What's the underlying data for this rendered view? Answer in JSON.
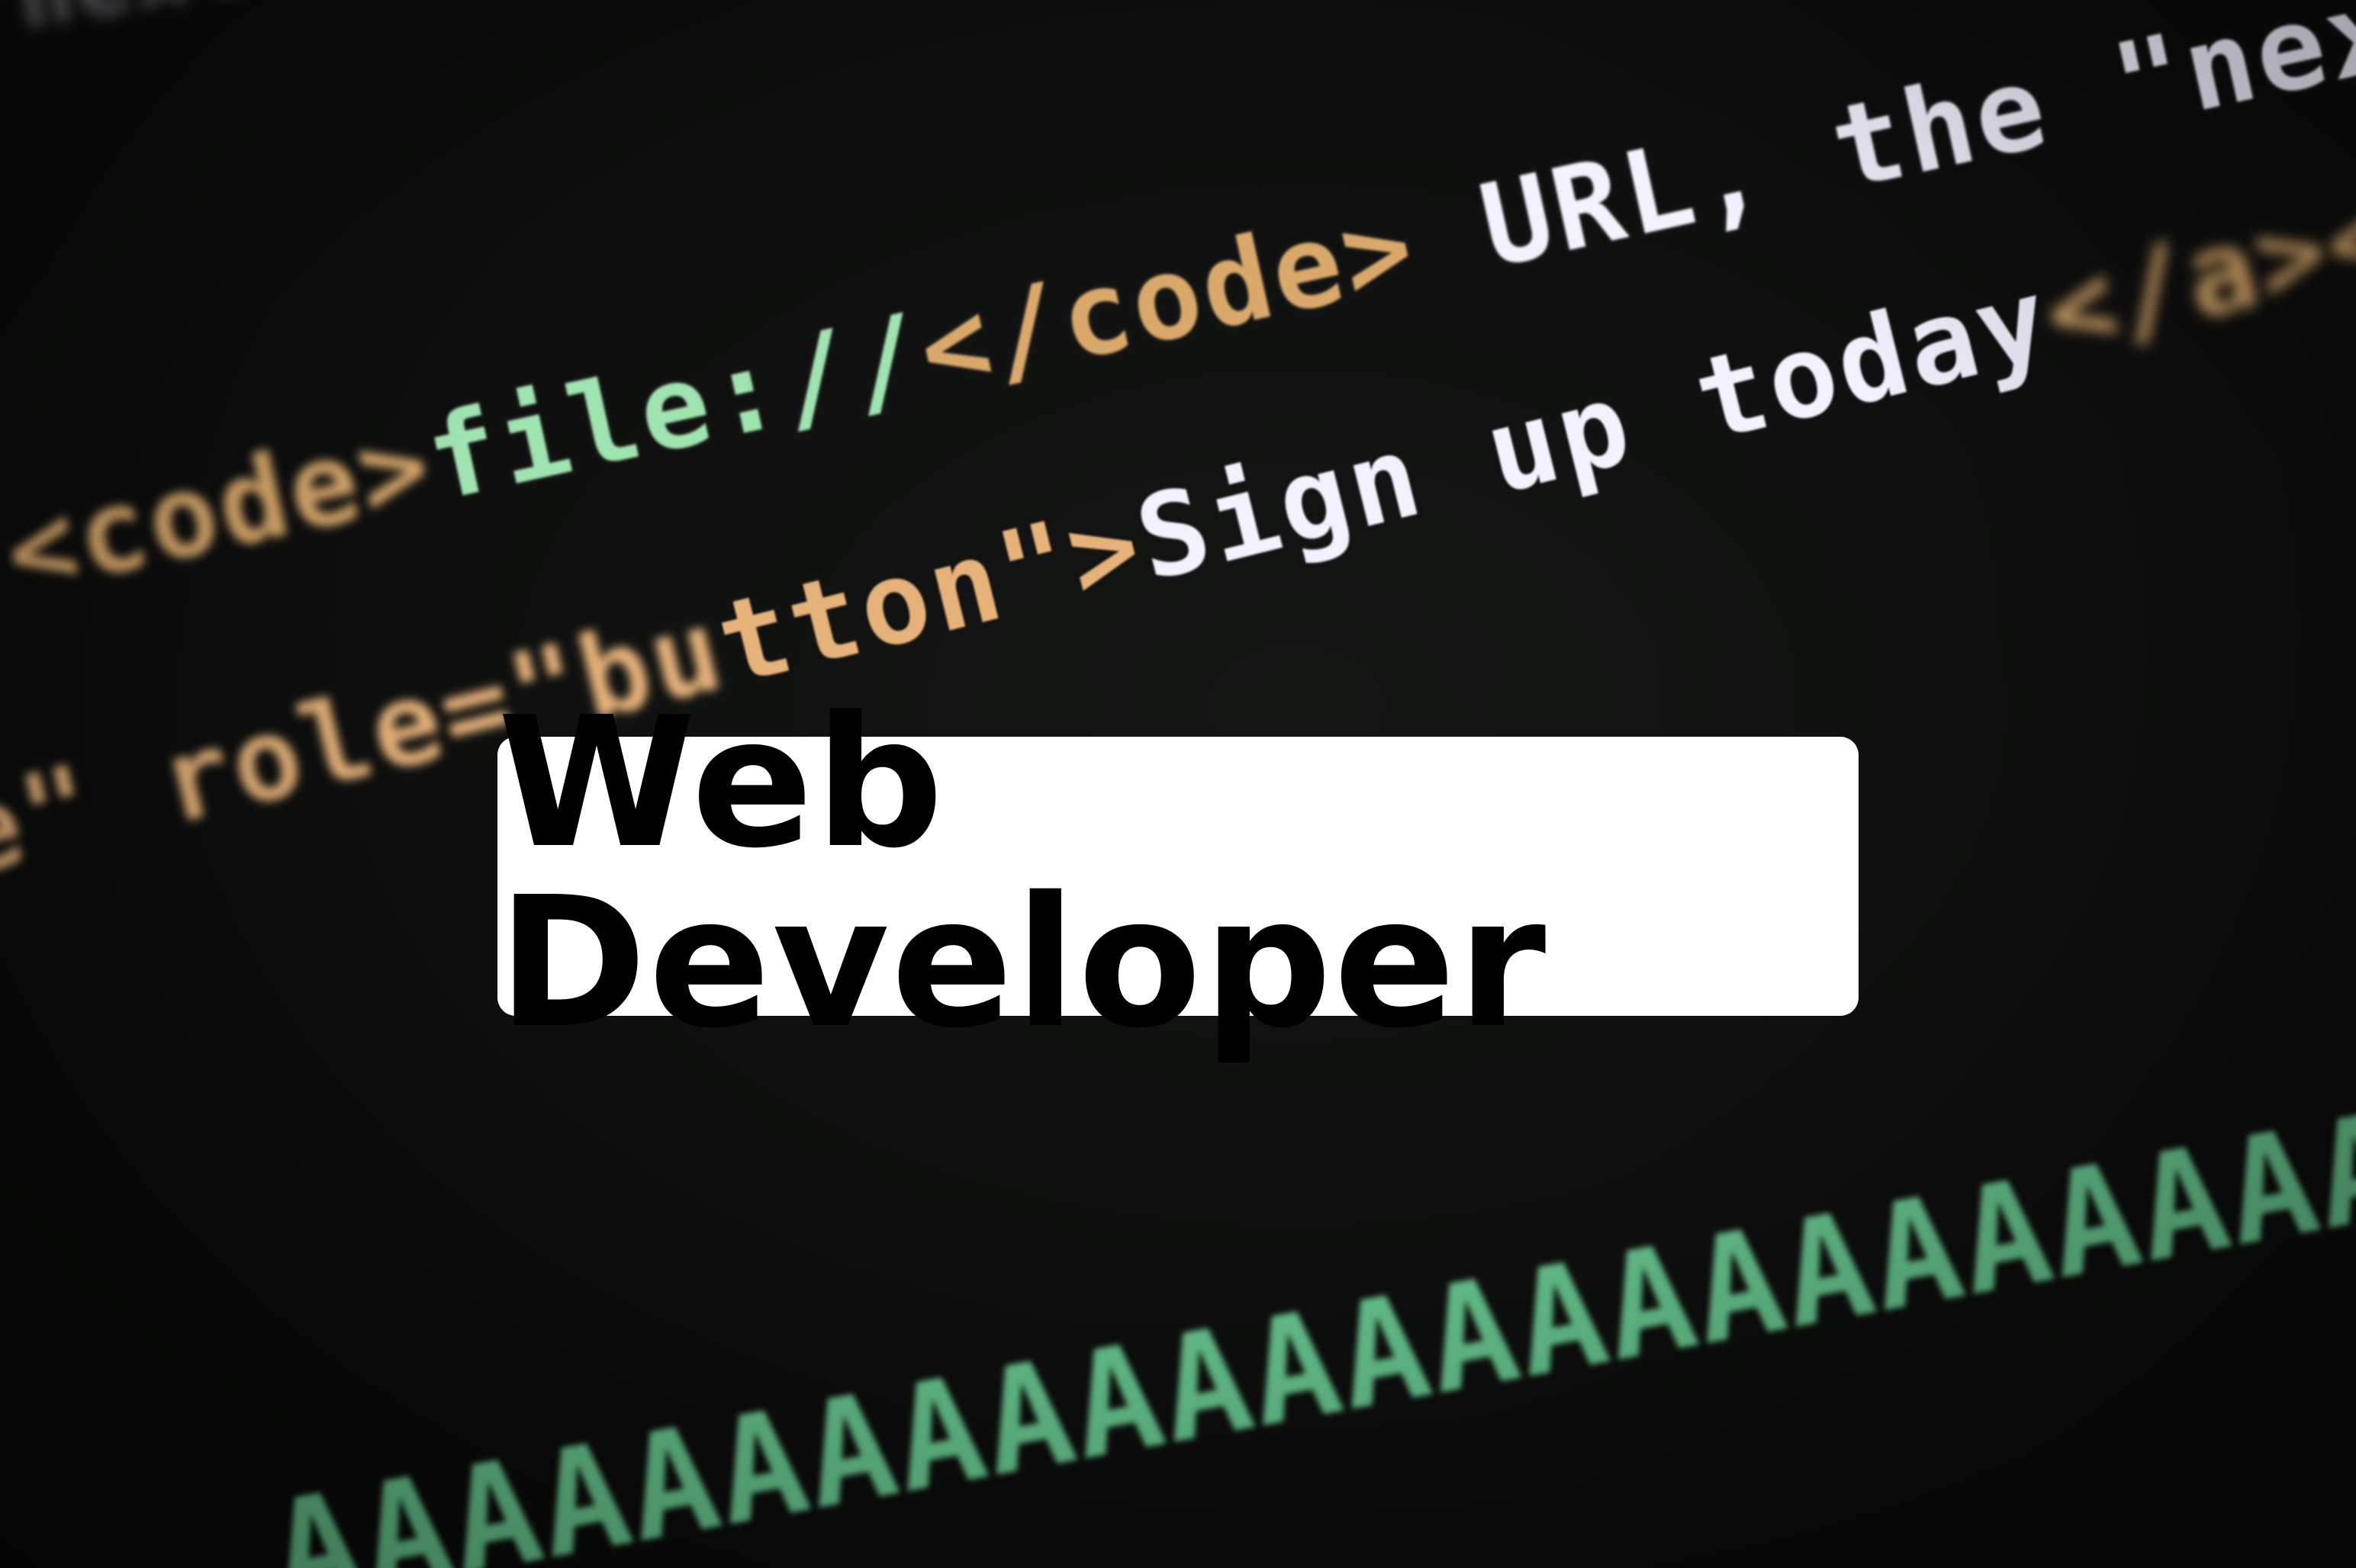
{
  "title": "Web Developer",
  "background_code": {
    "top_line": "\"next\" an",
    "line1": {
      "open_tag": "<code>",
      "path": "file://",
      "close_tag": "</code>",
      "text": "URL, the",
      "quoted": "\"next\""
    },
    "line2": {
      "attr_prefix": "e\" role=\"bu",
      "attr_hidden": "tton\">",
      "link_text": "Sign up today",
      "close_tags": "</a></p>"
    },
    "line3": {
      "text": "AAAAAAAAAAAAAAAAAAAAAAAAAAAAAAAICR"
    }
  },
  "colors": {
    "background": "#0b0c0b",
    "card": "#ffffff",
    "title": "#000000",
    "code_tag": "#d9a86a",
    "code_green": "#9fe3b0",
    "code_white": "#f4f1ff"
  }
}
